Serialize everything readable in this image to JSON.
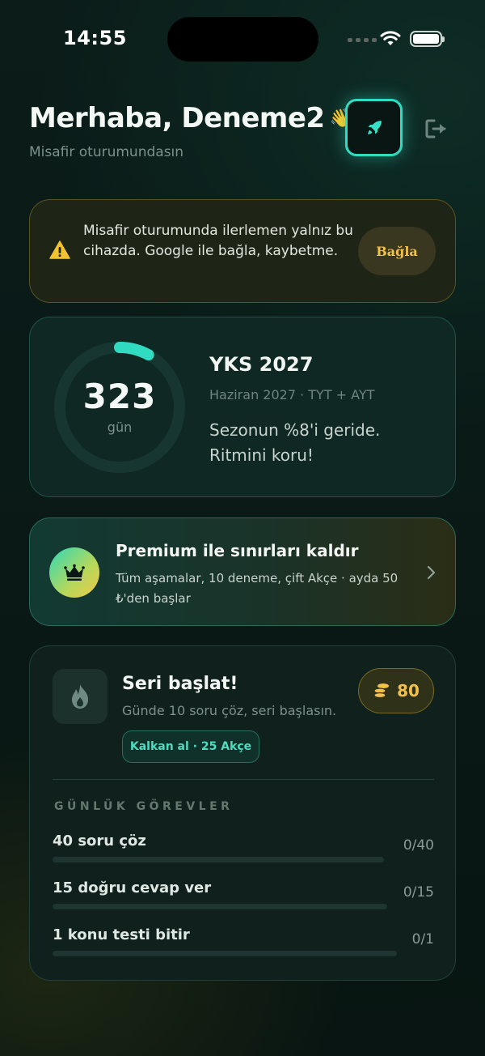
{
  "status_bar": {
    "time": "14:55"
  },
  "header": {
    "greeting": "Merhaba, Deneme2",
    "wave_emoji": "👋",
    "subtitle": "Misafir oturumundasın",
    "rocket_icon": "rocket-icon",
    "logout_icon": "logout-icon",
    "accent": "#2fdcc2"
  },
  "warning": {
    "icon": "warning-icon",
    "text": "Misafir oturumunda ilerlemen yalnız bu cihazda. Google ile bağla, kaybetme.",
    "button_label": "Bağla"
  },
  "exam": {
    "days": "323",
    "days_unit": "gün",
    "title": "YKS 2027",
    "subtitle": "Haziran 2027 · TYT + AYT",
    "message": "Sezonun %8'i geride. Ritmini koru!",
    "progress_fraction": 0.08
  },
  "premium": {
    "icon": "crown-icon",
    "title": "Premium ile sınırları kaldır",
    "description": "Tüm aşamalar, 10 deneme, çift Akçe · ayda 50 ₺'den başlar"
  },
  "streak": {
    "icon": "flame-icon",
    "title": "Seri başlat!",
    "subtitle": "Günde 10 soru çöz, seri başlasın.",
    "coins": "80",
    "shield_label": "Kalkan al · 25 Akçe"
  },
  "daily_tasks": {
    "heading": "GÜNLÜK GÖREVLER",
    "items": [
      {
        "label": "40 soru çöz",
        "count": "0/40",
        "progress": 0
      },
      {
        "label": "15 doğru cevap ver",
        "count": "0/15",
        "progress": 0
      },
      {
        "label": "1 konu testi bitir",
        "count": "0/1",
        "progress": 0
      }
    ]
  }
}
